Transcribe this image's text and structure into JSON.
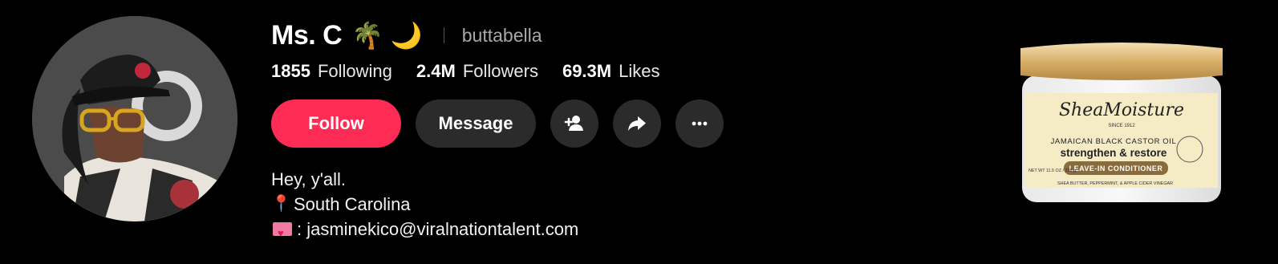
{
  "profile": {
    "display_name": "Ms. C",
    "emojis": "🌴 🌙",
    "handle": "buttabella"
  },
  "stats": [
    {
      "value": "1855",
      "label": "Following"
    },
    {
      "value": "2.4M",
      "label": "Followers"
    },
    {
      "value": "69.3M",
      "label": "Likes"
    }
  ],
  "actions": {
    "follow_label": "Follow",
    "message_label": "Message"
  },
  "bio": {
    "line1": "Hey, y'all.",
    "line2": "South Carolina",
    "line3": ": jasminekico@viralnationtalent.com"
  },
  "product": {
    "brand": "SheaMoisture",
    "since": "SINCE 1912",
    "subtitle": "JAMAICAN BLACK CASTOR OIL",
    "title": "strengthen & restore",
    "type": "LEAVE-IN CONDITIONER",
    "ingredients": "SHEA BUTTER, PEPPERMINT, & APPLE CIDER VINEGAR",
    "net_wt": "NET WT 11.5 OZ / 326 g"
  },
  "colors": {
    "follow": "#fe2c55",
    "button_dark": "#2b2b2b",
    "background": "#000000"
  },
  "icons": [
    "add-friend-icon",
    "share-icon",
    "more-icon",
    "location-pin-icon",
    "envelope-icon"
  ]
}
